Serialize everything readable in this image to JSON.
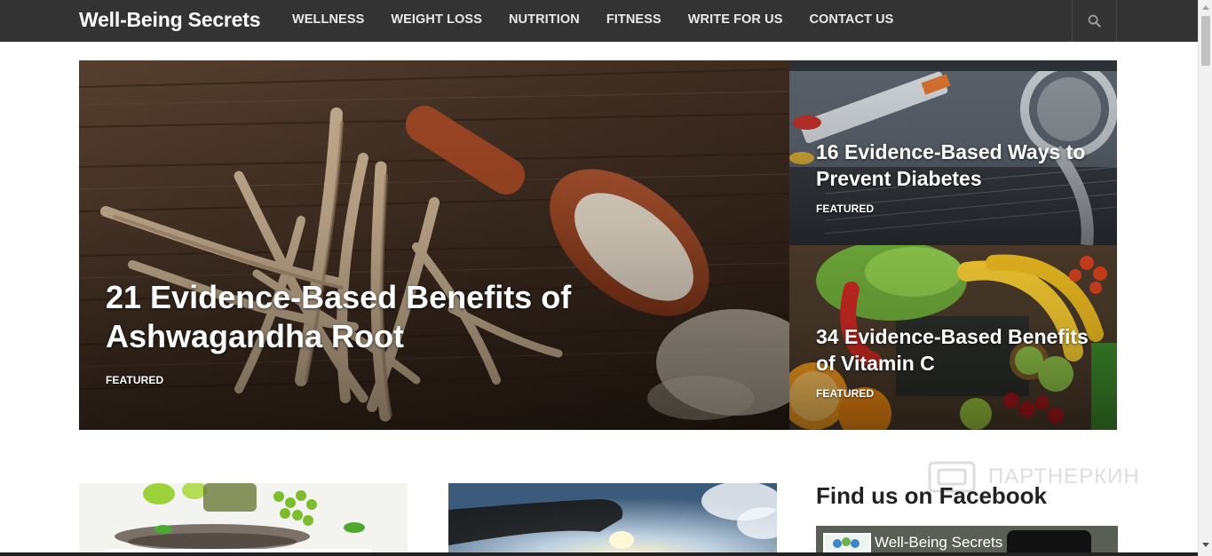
{
  "site": {
    "logo": "Well-Being Secrets"
  },
  "nav": {
    "items": [
      {
        "label": "WELLNESS"
      },
      {
        "label": "WEIGHT LOSS"
      },
      {
        "label": "NUTRITION"
      },
      {
        "label": "FITNESS"
      },
      {
        "label": "WRITE FOR US"
      },
      {
        "label": "CONTACT US"
      }
    ],
    "search_icon": "search-icon"
  },
  "hero": {
    "main": {
      "title": "21 Evidence-Based Benefits of Ashwagandha Root",
      "category": "FEATURED",
      "image": "ashwagandha-roots-and-powder-scoop"
    },
    "top": {
      "title": "16 Evidence-Based Ways to Prevent Diabetes",
      "category": "FEATURED",
      "image": "syringe-stethoscope-diabetes"
    },
    "bottom": {
      "title": "34 Evidence-Based Benefits of Vitamin C",
      "category": "FEATURED",
      "image": "fruits-vegetables-vitamin-c"
    }
  },
  "posts": [
    {
      "image": "chia-seeds-limes-grapes"
    },
    {
      "image": "hand-holding-sun-sky"
    }
  ],
  "sidebar": {
    "heading": "Find us on Facebook",
    "facebook_page_name": "Well-Being Secrets"
  },
  "watermark": {
    "text": "ПАРТНЕРКИН"
  },
  "colors": {
    "topbar": "#333333",
    "nav_text": "#e9e9e9",
    "heading_text": "#222222"
  }
}
